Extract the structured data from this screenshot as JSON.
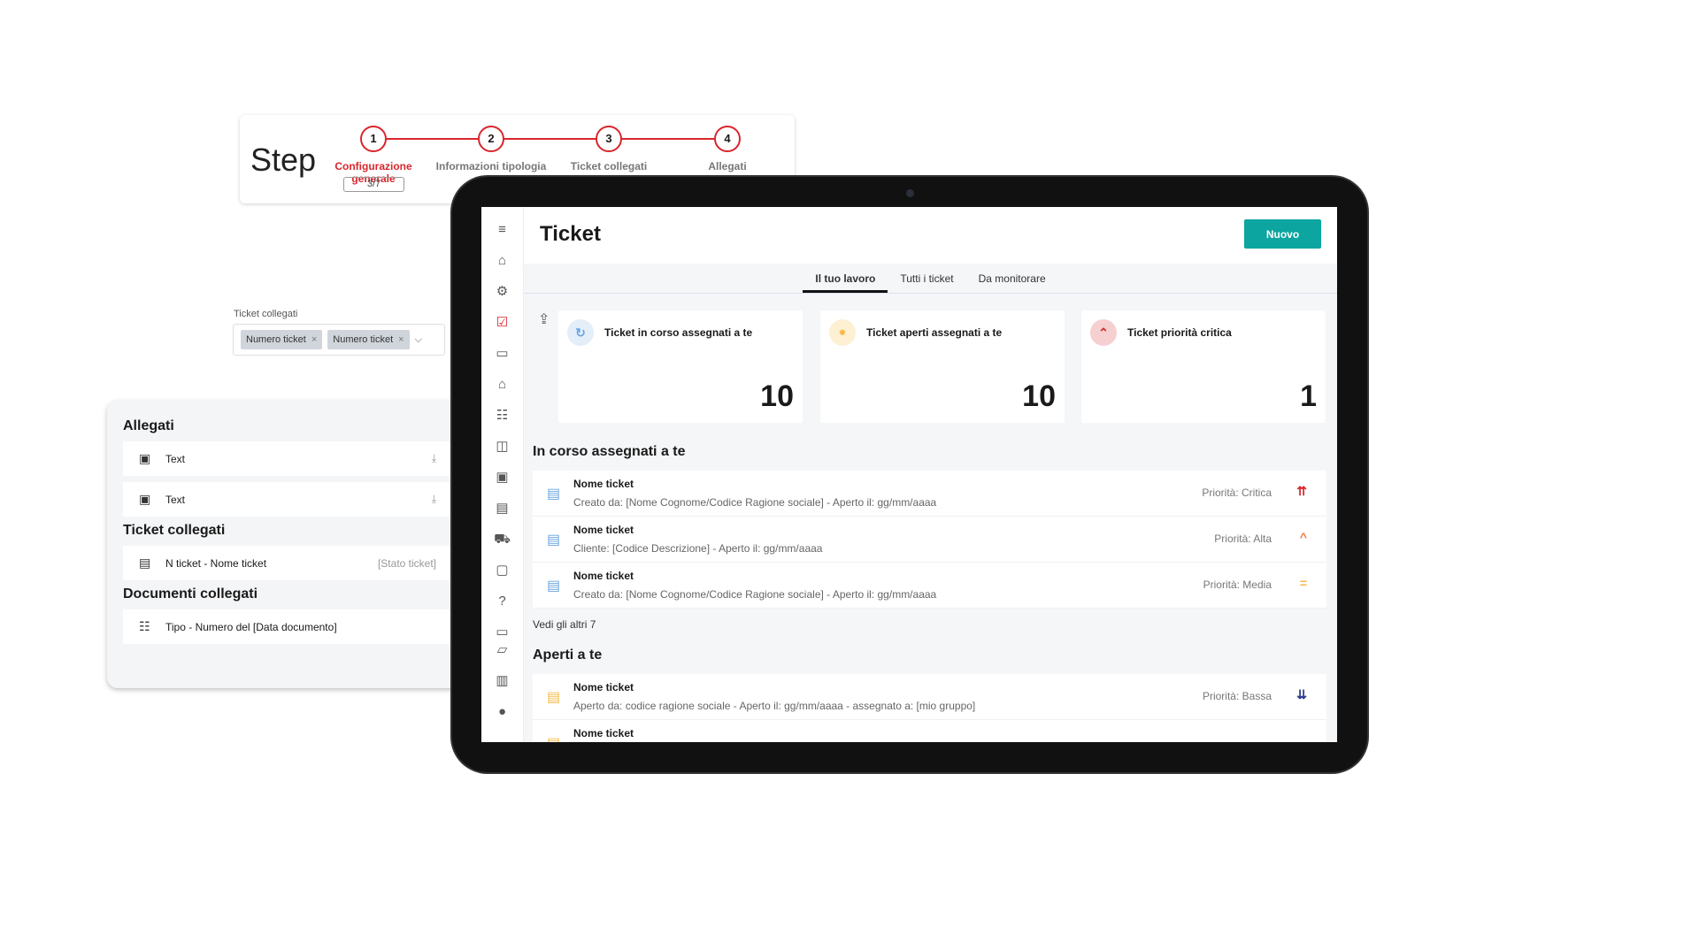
{
  "stepper": {
    "word": "Step",
    "steps": [
      {
        "n": "1",
        "label": "Configurazione generale"
      },
      {
        "n": "2",
        "label": "Informazioni tipologia"
      },
      {
        "n": "3",
        "label": "Ticket collegati"
      },
      {
        "n": "4",
        "label": "Allegati"
      }
    ],
    "count": "3/7",
    "active_color": "#d9262c"
  },
  "linked_field": {
    "label": "Ticket collegati",
    "chips": [
      "Numero ticket",
      "Numero ticket"
    ]
  },
  "left_panel": {
    "allegati_title": "Allegati",
    "allegati": [
      "Text",
      "Text"
    ],
    "ticket_title": "Ticket collegati",
    "tickets": [
      {
        "name": "N ticket - Nome ticket",
        "status": "[Stato ticket]"
      }
    ],
    "docs_title": "Documenti collegati",
    "docs": [
      "Tipo - Numero del [Data documento]"
    ]
  },
  "app": {
    "title": "Ticket",
    "new_button": "Nuovo",
    "accent": "#0ca5a0",
    "sidebar": [
      "menu-icon",
      "home-icon",
      "gear-icon",
      "checklist-icon",
      "contact-card-icon",
      "warehouse-icon",
      "list-icon",
      "widgets-icon",
      "briefcase-icon",
      "library-icon",
      "cart-icon",
      "archive-icon",
      "help-icon",
      "folder-icon",
      "forum-icon",
      "building-icon",
      "account-icon"
    ],
    "tabs": [
      "Il tuo lavoro",
      "Tutti i ticket",
      "Da monitorare"
    ],
    "cards": [
      {
        "label": "Ticket in corso assegnati a te",
        "value": "10",
        "icon": "progress-icon"
      },
      {
        "label": "Ticket aperti assegnati a te",
        "value": "10",
        "icon": "new-badge-icon"
      },
      {
        "label": "Ticket priorità critica",
        "value": "1",
        "icon": "double-chevron-up-icon"
      }
    ],
    "in_corso": {
      "title": "In corso assegnati a te",
      "rows": [
        {
          "name": "Nome ticket",
          "desc": "Creato da: [Nome Cognome/Codice Ragione sociale] - Aperto il: gg/mm/aaaa",
          "priority": "Priorità: Critica",
          "icon": "double-chevron-up-icon",
          "color": "#d9262c"
        },
        {
          "name": "Nome ticket",
          "desc": "Cliente: [Codice Descrizione] - Aperto il: gg/mm/aaaa",
          "priority": "Priorità: Alta",
          "icon": "chevron-up-icon",
          "color": "#f07b3f"
        },
        {
          "name": "Nome ticket",
          "desc": "Creato da: [Nome Cognome/Codice Ragione sociale] - Aperto il: gg/mm/aaaa",
          "priority": "Priorità: Media",
          "icon": "equals-icon",
          "color": "#f5b942"
        }
      ],
      "more": "Vedi gli altri 7"
    },
    "aperti": {
      "title": "Aperti a te",
      "rows": [
        {
          "name": "Nome ticket",
          "desc": "Aperto da: codice ragione sociale - Aperto il: gg/mm/aaaa - assegnato a: [mio gruppo]",
          "priority": "Priorità: Bassa",
          "icon": "double-chevron-down-icon",
          "color": "#2b3a8c"
        },
        {
          "name": "Nome ticket"
        }
      ]
    }
  }
}
